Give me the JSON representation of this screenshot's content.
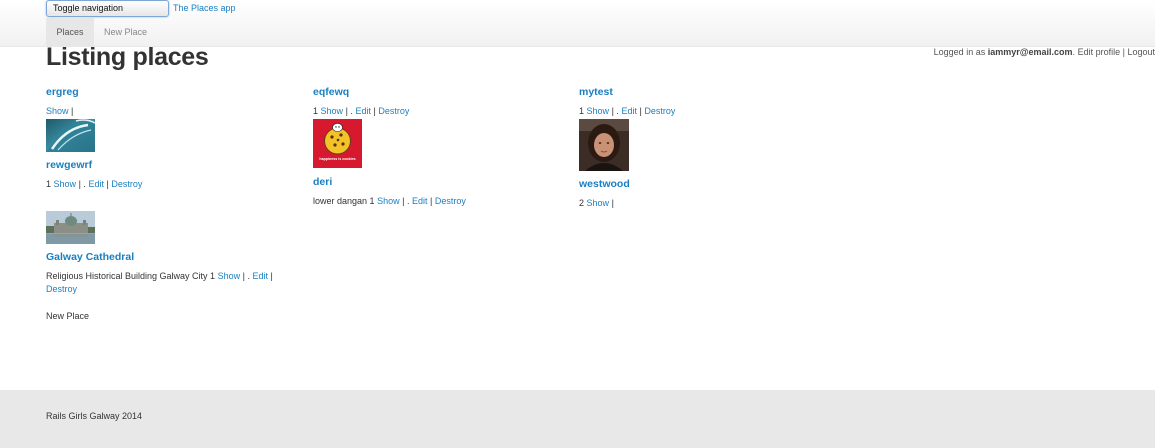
{
  "navbar": {
    "toggle_label": "Toggle navigation",
    "brand": "The Places app",
    "tabs": [
      {
        "label": "Places",
        "active": true
      },
      {
        "label": "New Place",
        "active": false
      }
    ]
  },
  "login": {
    "prefix": "Logged in as ",
    "email": "iammyr@email.com",
    "period": ".",
    "edit_profile": "Edit profile",
    "sep": "|",
    "logout": "Logout"
  },
  "page_title": "Listing places",
  "links": {
    "show": "Show",
    "edit": "Edit",
    "destroy": "Destroy",
    "pipe": "|",
    "dot": "."
  },
  "places": [
    {
      "name": "ergreg",
      "prefix": "",
      "thumbnail": "ocean-wave"
    },
    {
      "name": "rewgewrf",
      "prefix": "1",
      "thumbnail": "cathedral"
    },
    {
      "name": "Galway Cathedral",
      "prefix": "Religious Historical Building Galway City 1"
    },
    {
      "name": "eqfewq",
      "prefix": "1",
      "thumbnail": "cookie-cartoon"
    },
    {
      "name": "deri",
      "prefix": "lower dangan 1"
    },
    {
      "name": "mytest",
      "prefix": "1",
      "thumbnail": "woman-portrait"
    },
    {
      "name": "westwood",
      "prefix": "2"
    }
  ],
  "thumb_text": {
    "cookie": "happiness is cookies"
  },
  "new_place_link": "New Place",
  "footer": "Rails Girls Galway 2014",
  "colors": {
    "link": "#1a7fc1",
    "footer_bg": "#e8e8e8",
    "navbar_bg": "#f5f5f5"
  }
}
